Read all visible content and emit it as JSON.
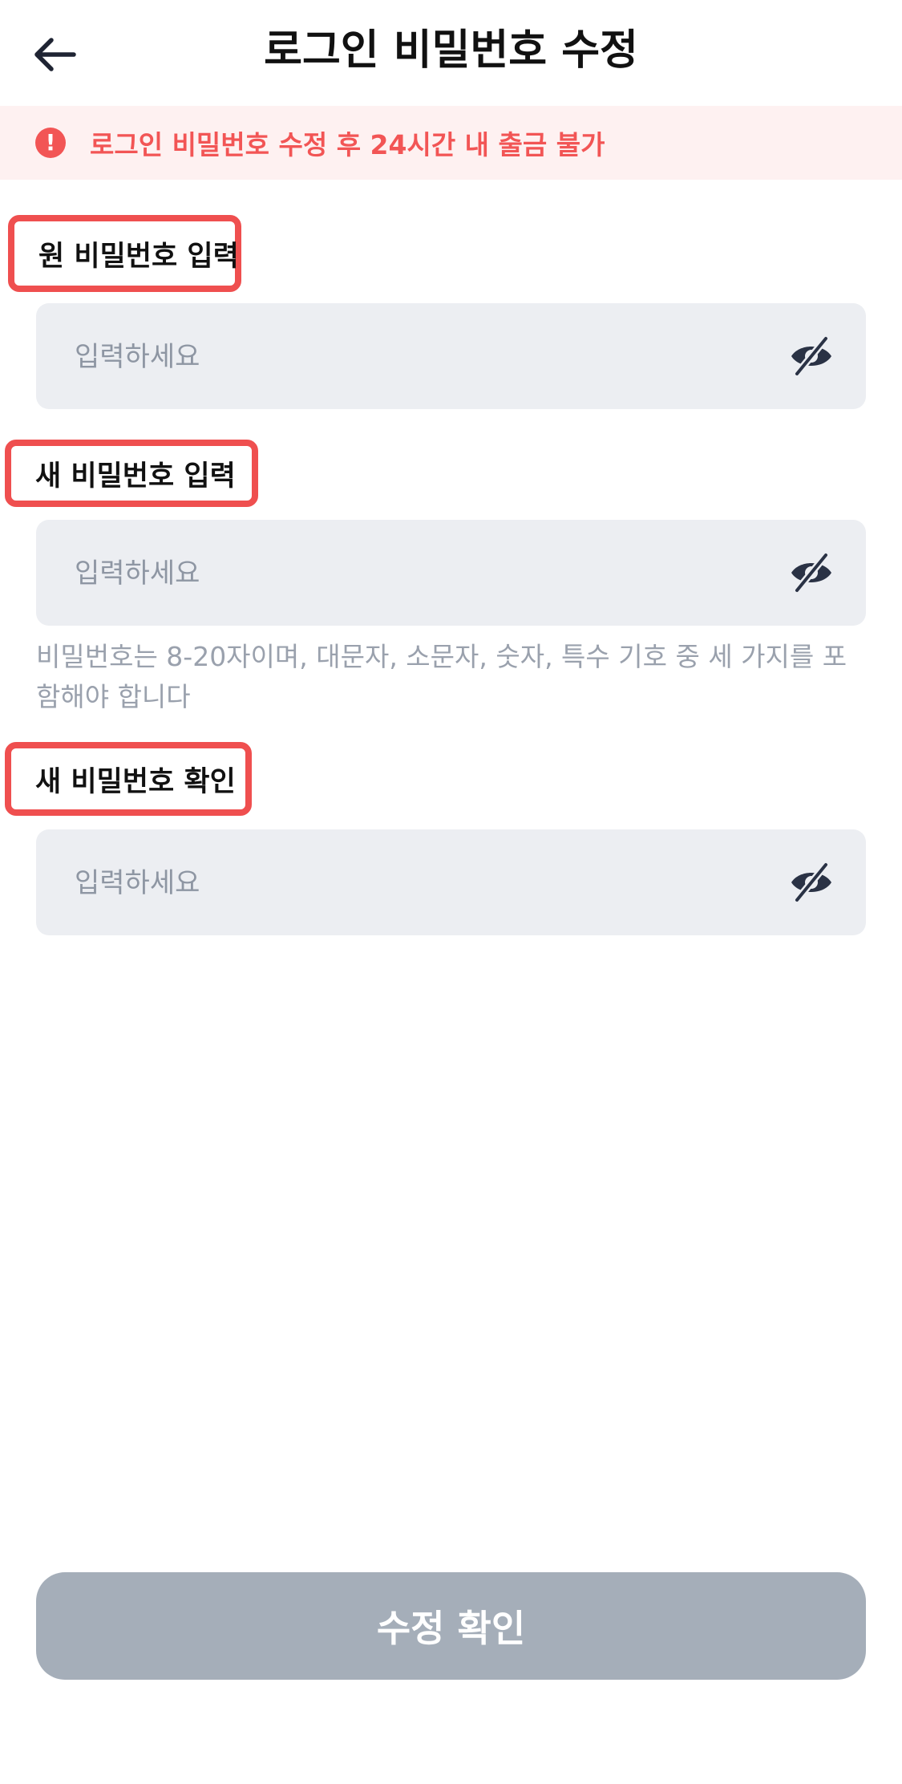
{
  "header": {
    "title": "로그인 비밀번호 수정"
  },
  "banner": {
    "icon_glyph": "!",
    "text": "로그인 비밀번호 수정 후 24시간 내 출금 불가",
    "color": "#f25555",
    "background": "#fef1f1"
  },
  "fields": [
    {
      "label": "원 비밀번호 입력",
      "placeholder": "입력하세요",
      "icon": "eye-off-icon"
    },
    {
      "label": "새 비밀번호 입력",
      "placeholder": "입력하세요",
      "icon": "eye-off-icon"
    },
    {
      "label": "새 비밀번호 확인",
      "placeholder": "입력하세요",
      "icon": "eye-off-icon"
    }
  ],
  "hint": "비밀번호는 8-20자이며, 대문자, 소문자, 숫자, 특수 기호 중 세 가지를 포함해야 합니다",
  "submit": {
    "label": "수정 확인",
    "background": "#a5aeb9"
  },
  "highlight_color": "#ef4f4f"
}
